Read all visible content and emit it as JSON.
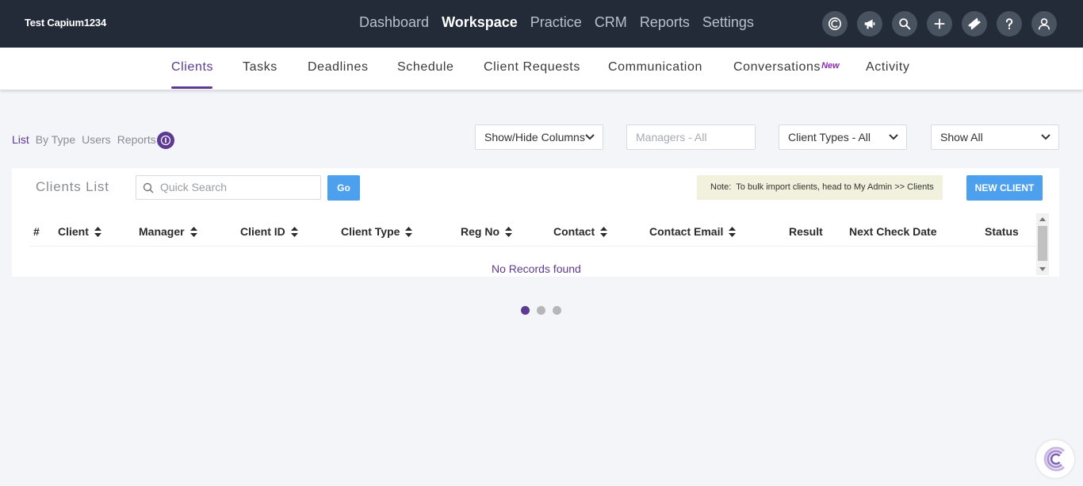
{
  "header": {
    "brand": "Test Capium1234",
    "nav": [
      "Dashboard",
      "Workspace",
      "Practice",
      "CRM",
      "Reports",
      "Settings"
    ],
    "active_nav": "Workspace",
    "icons": [
      "capium-logo-icon",
      "megaphone-icon",
      "search-icon",
      "plus-icon",
      "ticket-icon",
      "help-icon",
      "user-icon"
    ]
  },
  "subnav": {
    "items": [
      "Clients",
      "Tasks",
      "Deadlines",
      "Schedule",
      "Client Requests",
      "Communication",
      "Conversations",
      "Activity"
    ],
    "new_badge": "New",
    "active": "Clients"
  },
  "views": {
    "tabs": [
      "List",
      "By Type",
      "Users",
      "Reports"
    ],
    "active": "List"
  },
  "filters": {
    "columns": "Show/Hide Columns",
    "managers_placeholder": "Managers - All",
    "client_types": "Client Types - All",
    "show": "Show All"
  },
  "panel": {
    "title": "Clients List",
    "search_placeholder": "Quick Search",
    "go": "Go",
    "note_label": "Note:",
    "note_text": "To bulk import clients, head to My Admin >> Clients",
    "new_client": "NEW CLIENT",
    "columns": [
      "#",
      "Client",
      "Manager",
      "Client ID",
      "Client Type",
      "Reg No",
      "Contact",
      "Contact Email",
      "Result",
      "Next Check Date",
      "Status"
    ],
    "empty_message": "No Records found"
  },
  "pager": {
    "pages": 3,
    "active": 1
  },
  "colors": {
    "accent": "#5c3a93",
    "button": "#4da0ee",
    "topbar": "#222b37"
  }
}
